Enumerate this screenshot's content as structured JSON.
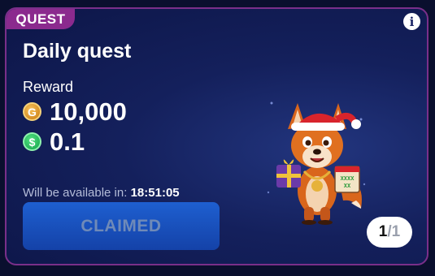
{
  "card": {
    "tag": "QUEST",
    "info_icon": "i",
    "title": "Daily quest",
    "reward_label": "Reward",
    "rewards": [
      {
        "icon": "gold-coin-icon",
        "symbol": "G",
        "amount": "10,000"
      },
      {
        "icon": "green-coin-icon",
        "symbol": "$",
        "amount": "0.1"
      }
    ],
    "availability_text": "Will be available in:",
    "countdown": "18:51:05",
    "button_label": "CLAIMED",
    "pager": {
      "current": "1",
      "separator": "/",
      "total": "1"
    },
    "mascot_calendar_text": "XXXX\nXX"
  },
  "colors": {
    "card_border": "#7a2f8a",
    "tag_bg": "#8b2a8e",
    "button_bg": "#1a50bc",
    "button_text": "#6f8ab8"
  }
}
